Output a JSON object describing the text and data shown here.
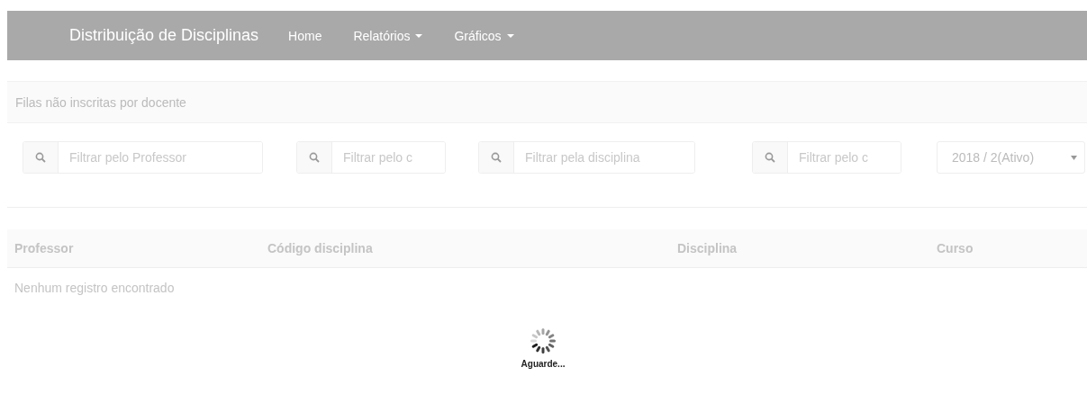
{
  "navbar": {
    "brand": "Distribuição de Disciplinas",
    "items": [
      {
        "label": "Home",
        "dropdown": false
      },
      {
        "label": "Relatórios",
        "dropdown": true
      },
      {
        "label": "Gráficos",
        "dropdown": true
      }
    ]
  },
  "panel": {
    "title": "Filas não inscritas por docente"
  },
  "filters": [
    {
      "placeholder": "Filtrar pelo Professor"
    },
    {
      "placeholder": "Filtrar pelo c"
    },
    {
      "placeholder": "Filtrar pela disciplina"
    },
    {
      "placeholder": "Filtrar pelo c"
    }
  ],
  "period_select": {
    "value": "2018 / 2(Ativo)"
  },
  "table": {
    "columns": [
      "Professor",
      "Código disciplina",
      "Disciplina",
      "Curso"
    ],
    "empty_message": "Nenhum registro encontrado"
  },
  "loading": {
    "label": "Aguarde..."
  }
}
